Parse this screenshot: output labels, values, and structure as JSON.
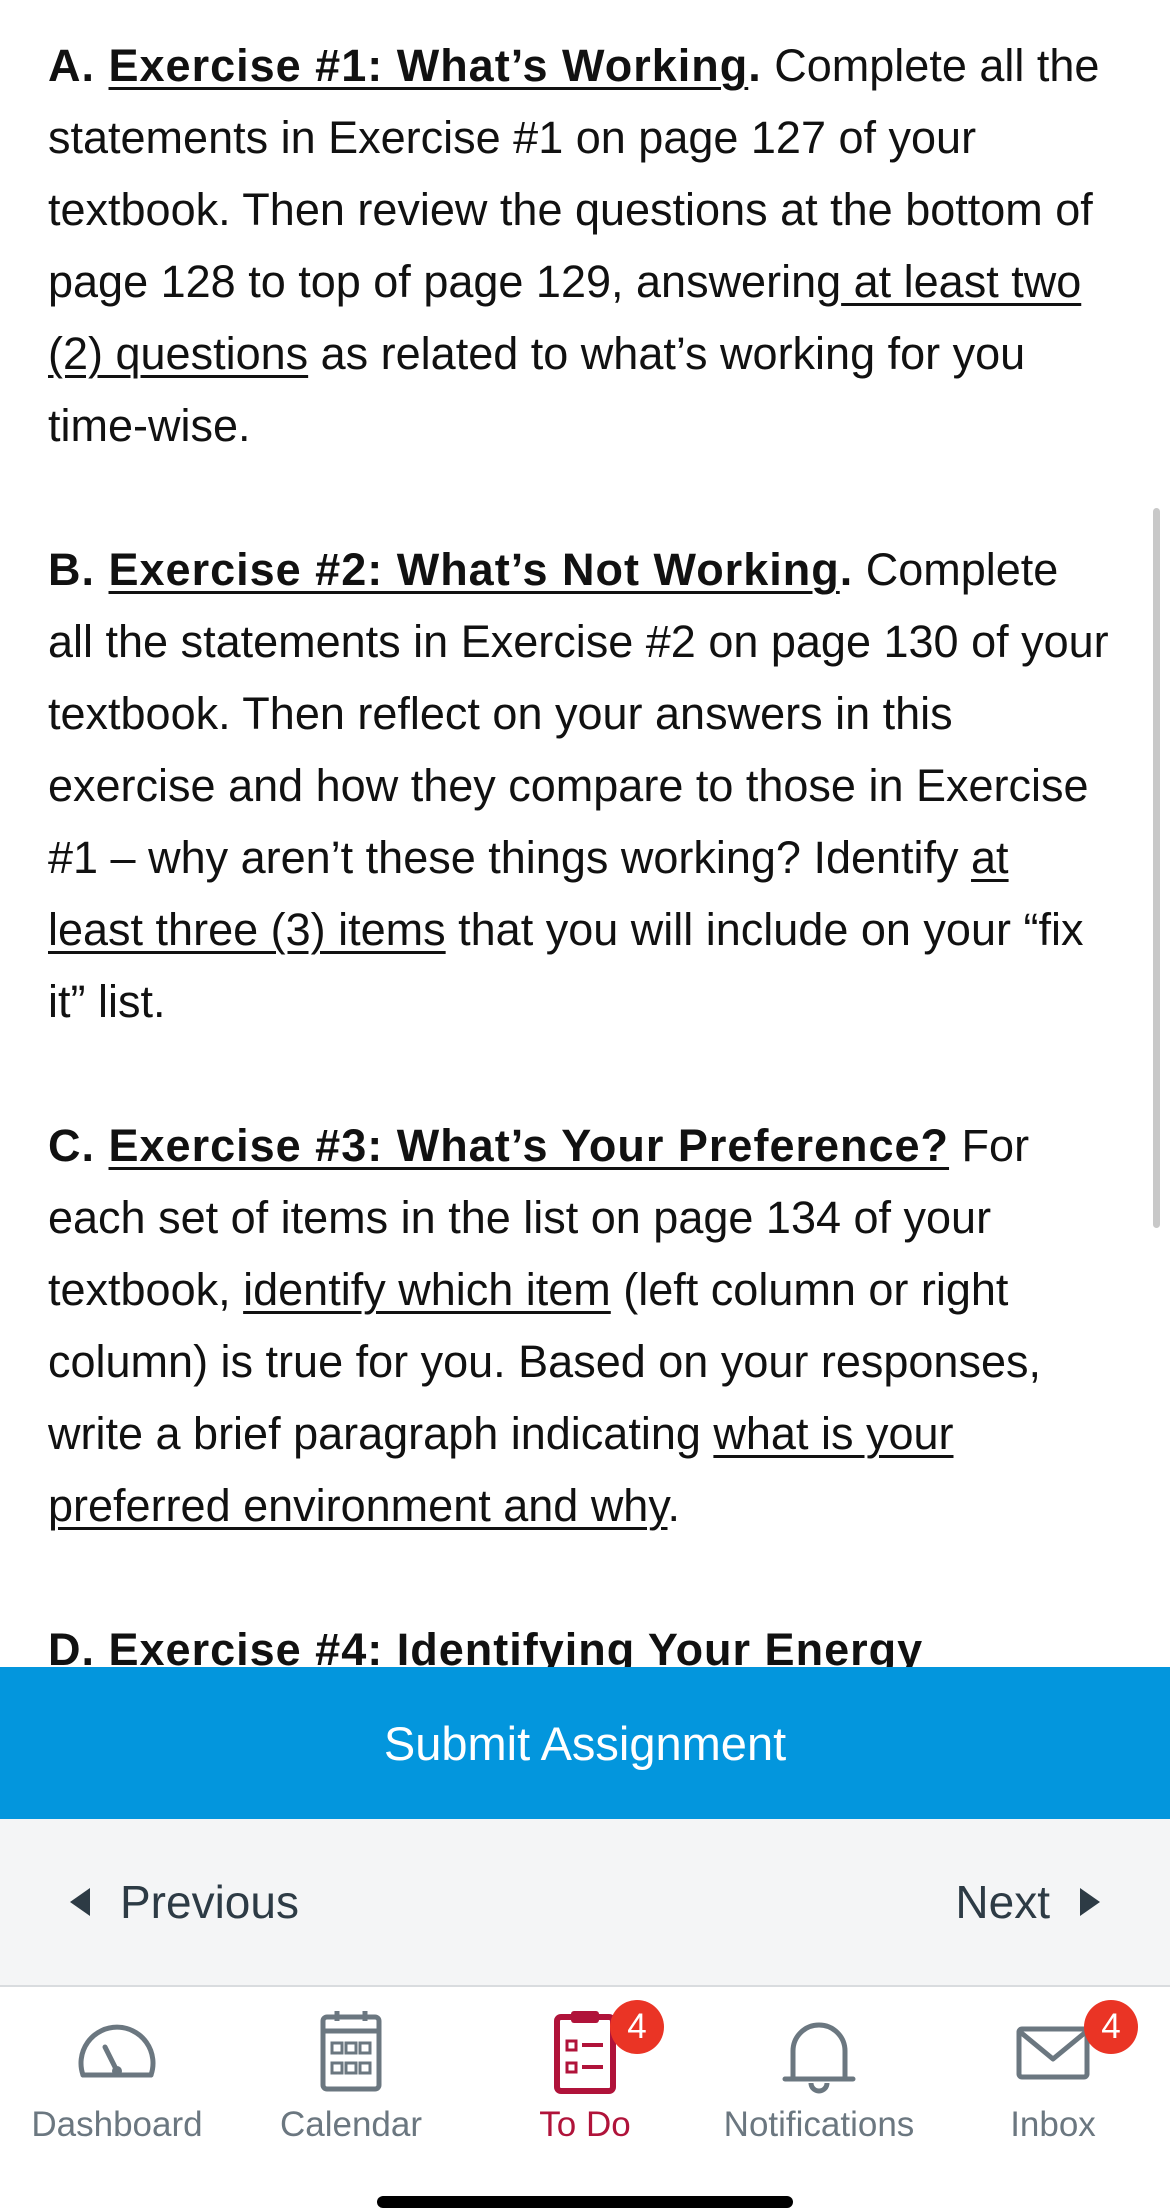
{
  "assignment": {
    "a": {
      "letter": "A. ",
      "title": "Exercise #1: What’s Working",
      "title_end": ".",
      "t1": " Complete all the statements in Exercise #1 on page 127 of your textbook. Then review the questions at the bottom of page 128 to top of page 129, answering",
      "u1": " at least two (2) questions",
      "t2": " as related to what’s working for you time-wise."
    },
    "b": {
      "letter": "B. ",
      "title": "Exercise #2: What’s Not Working",
      "title_end": ".",
      "t1": " Complete all the statements in Exercise #2 on page 130 of your textbook. Then reflect on your answers in this exercise and how they compare to those in Exercise #1 – why aren’t these things working? Identify ",
      "u1": "at least three (3) items",
      "t2": " that you will include on your “fix it” list."
    },
    "c": {
      "letter": "C. ",
      "title": "Exercise #3: What’s Your Preference?",
      "t1": " For each set of items in the list on page 134 of your textbook, ",
      "u1": "identify which item",
      "t2": " (left column or right column) is true for you. Based on your responses, write a brief paragraph indicating ",
      "u2": "what is your preferred environment and why",
      "t3": "."
    },
    "d": {
      "letter": "D. ",
      "title": "Exercise #4: Identifying Your Energy"
    }
  },
  "submit_label": "Submit Assignment",
  "pager": {
    "previous": "Previous",
    "next": "Next"
  },
  "tabs": [
    {
      "label": "Dashboard",
      "icon": "dashboard-gauge-icon"
    },
    {
      "label": "Calendar",
      "icon": "calendar-icon"
    },
    {
      "label": "To Do",
      "icon": "todo-clipboard-icon",
      "badge": "4",
      "active": true
    },
    {
      "label": "Notifications",
      "icon": "bell-icon"
    },
    {
      "label": "Inbox",
      "icon": "envelope-icon",
      "badge": "4"
    }
  ],
  "colors": {
    "submit_bg": "#0396dd",
    "active_tab": "#b0133a",
    "inactive_tab": "#6b7780",
    "badge": "#ea3425"
  }
}
